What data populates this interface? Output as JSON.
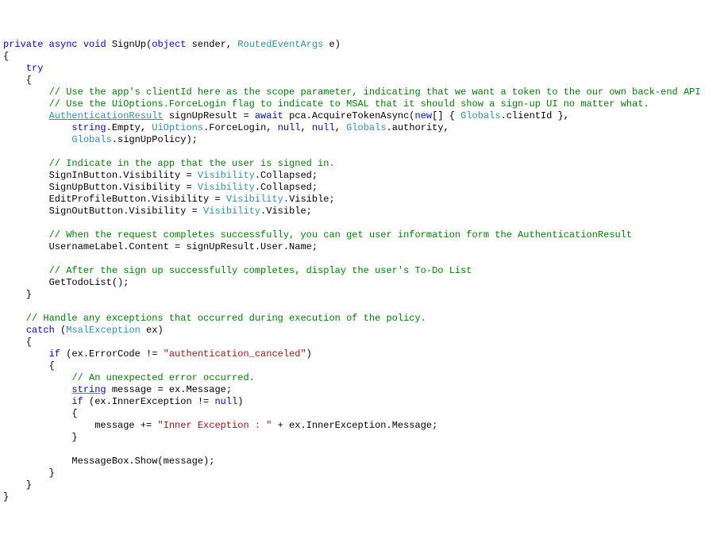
{
  "code": {
    "l1": {
      "kw0": "private",
      "kw1": "async",
      "kw2": "void",
      "name": " SignUp(",
      "kw3": "object",
      "sender": " sender, ",
      "type": "RoutedEventArgs",
      "rest": " e)"
    },
    "l2": "{",
    "l3": {
      "kw": "try"
    },
    "l4": "    {",
    "l5": "        // Use the app's clientId here as the scope parameter, indicating that we want a token to the our own back-end API",
    "l6": "        // Use the UiOptions.ForceLogin flag to indicate to MSAL that it should show a sign-up UI no matter what.",
    "l7": {
      "indent": "        ",
      "type": "AuthenticationResult",
      "a": " signUpResult = ",
      "kw_await": "await",
      "b": " pca.AcquireTokenAsync(",
      "kw_new": "new",
      "c": "[] { ",
      "type2": "Globals",
      "d": ".clientId },"
    },
    "l8": {
      "indent": "            ",
      "kw_string": "string",
      "a": ".Empty, ",
      "type": "UiOptions",
      "b": ".ForceLogin, ",
      "kw_null1": "null",
      "c": ", ",
      "kw_null2": "null",
      "d": ", ",
      "type2": "Globals",
      "e": ".authority,"
    },
    "l9": {
      "indent": "            ",
      "type": "Globals",
      "rest": ".signUpPolicy);"
    },
    "l11": "        // Indicate in the app that the user is signed in.",
    "l12": {
      "indent": "        ",
      "a": "SignInButton.Visibility = ",
      "type": "Visibility",
      "rest": ".Collapsed;"
    },
    "l13": {
      "indent": "        ",
      "a": "SignUpButton.Visibility = ",
      "type": "Visibility",
      "rest": ".Collapsed;"
    },
    "l14": {
      "indent": "        ",
      "a": "EditProfileButton.Visibility = ",
      "type": "Visibility",
      "rest": ".Visible;"
    },
    "l15": {
      "indent": "        ",
      "a": "SignOutButton.Visibility = ",
      "type": "Visibility",
      "rest": ".Visible;"
    },
    "l17": "        // When the request completes successfully, you can get user information form the AuthenticationResult",
    "l18": "        UsernameLabel.Content = signUpResult.User.Name;",
    "l20": "        // After the sign up successfully completes, display the user's To-Do List",
    "l21": "        GetTodoList();",
    "l22": "    }",
    "l24": "    // Handle any exceptions that occurred during execution of the policy.",
    "l25": {
      "indent": "    ",
      "kw": "catch",
      "a": " (",
      "type": "MsalException",
      "rest": " ex)"
    },
    "l26": "    {",
    "l27": {
      "indent": "        ",
      "kw": "if",
      "a": " (ex.ErrorCode != ",
      "str": "\"authentication_canceled\"",
      "rest": ")"
    },
    "l28": "        {",
    "l29": "            // An unexpected error occurred.",
    "l30": {
      "indent": "            ",
      "kw": "string",
      "rest": " message = ex.Message;"
    },
    "l31": {
      "indent": "            ",
      "kw": "if",
      "a": " (ex.InnerException != ",
      "kw_null": "null",
      "rest": ")"
    },
    "l32": "            {",
    "l33": {
      "indent": "                ",
      "a": "message += ",
      "str": "\"Inner Exception : \"",
      "rest": " + ex.InnerException.Message;"
    },
    "l34": "            }",
    "l36": "            MessageBox.Show(message);",
    "l37": "        }",
    "l38": "    }",
    "l39": "}"
  }
}
